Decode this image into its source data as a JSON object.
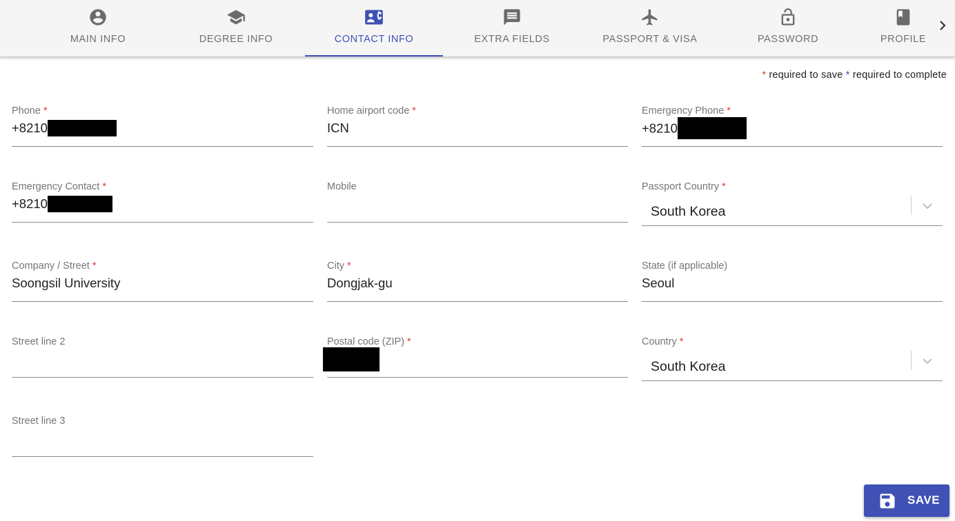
{
  "tabs": [
    {
      "label": "MAIN INFO",
      "icon": "account-circle-icon"
    },
    {
      "label": "DEGREE INFO",
      "icon": "graduation-cap-icon"
    },
    {
      "label": "CONTACT INFO",
      "icon": "contact-card-icon",
      "active": true
    },
    {
      "label": "EXTRA FIELDS",
      "icon": "comment-icon"
    },
    {
      "label": "PASSPORT & VISA",
      "icon": "airplane-icon"
    },
    {
      "label": "PASSWORD",
      "icon": "lock-open-icon"
    },
    {
      "label": "PROFILE",
      "icon": "portrait-icon"
    }
  ],
  "legend": {
    "star": "*",
    "save_text": "required to save",
    "complete_text": "required to complete"
  },
  "fields": {
    "phone": {
      "label": "Phone",
      "required": "*",
      "value": "+8210"
    },
    "home_airport": {
      "label": "Home airport code",
      "required": "*",
      "value": "ICN"
    },
    "emergency_phone": {
      "label": "Emergency Phone",
      "required": "*",
      "value": "+8210"
    },
    "emergency_contact": {
      "label": "Emergency Contact",
      "required": "*",
      "value": "+8210"
    },
    "mobile": {
      "label": "Mobile",
      "value": ""
    },
    "passport_country": {
      "label": "Passport Country",
      "required": "*",
      "value": "South Korea"
    },
    "company_street": {
      "label": "Company / Street",
      "required": "*",
      "value": "Soongsil University"
    },
    "city": {
      "label": "City",
      "required": "*",
      "value": "Dongjak-gu"
    },
    "state": {
      "label": "State (if applicable)",
      "value": "Seoul"
    },
    "street_line_2": {
      "label": "Street line 2",
      "value": ""
    },
    "postal_code": {
      "label": "Postal code (ZIP)",
      "required": "*",
      "value": ""
    },
    "country": {
      "label": "Country",
      "required": "*",
      "value": "South Korea"
    },
    "street_line_3": {
      "label": "Street line 3",
      "value": ""
    }
  },
  "save_button": {
    "label": "SAVE",
    "icon": "floppy-disk-icon"
  },
  "colors": {
    "accent": "#3f51b5",
    "required_star": "#e53935",
    "tab_bar_bg": "#f5f5f5"
  }
}
